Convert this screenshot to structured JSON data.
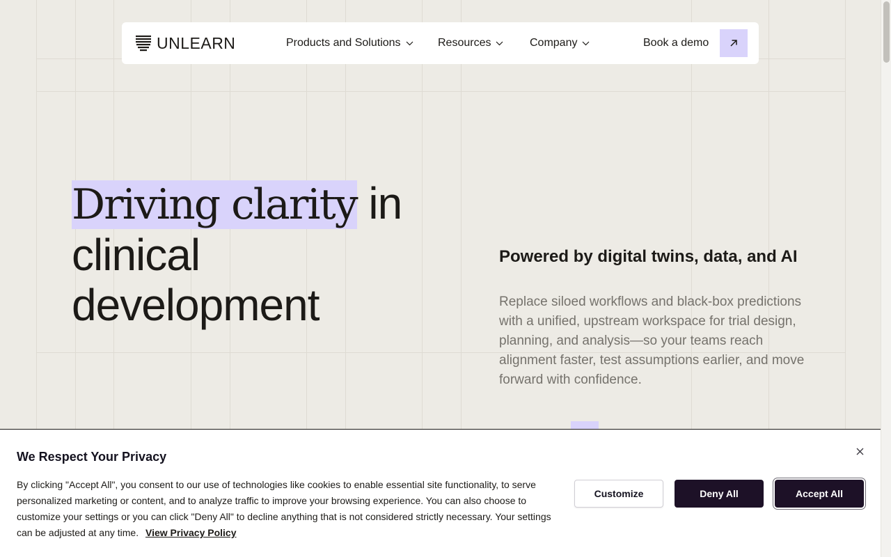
{
  "nav": {
    "logo_text": "UNLEARN",
    "items": [
      {
        "label": "Products and Solutions"
      },
      {
        "label": "Resources"
      },
      {
        "label": "Company"
      }
    ],
    "cta_label": "Book a demo"
  },
  "hero": {
    "title_highlight": "Driving clarity",
    "title_in": " in",
    "title_line2": "clinical",
    "title_line3": "development",
    "subtitle": "Powered by digital twins, data, and AI",
    "description": "Replace siloed workflows and black-box predictions with a unified, upstream workspace for trial design, planning, and analysis—so your teams reach alignment faster, test assumptions earlier, and move forward with confidence."
  },
  "cookie": {
    "title": "We Respect Your Privacy",
    "body": "By clicking \"Accept All\", you consent to our use of technologies like cookies to enable essential site functionality, to serve personalized marketing or content, and to analyze traffic to improve your browsing experience. You can also choose to customize your settings or you can click \"Deny All\" to decline anything that is not considered strictly necessary. Your settings can be adjusted at any time.",
    "policy_link": "View Privacy Policy",
    "customize_label": "Customize",
    "deny_label": "Deny All",
    "accept_label": "Accept All"
  },
  "colors": {
    "background": "#edebe5",
    "accent": "#d9d3fb",
    "dark_button": "#1d1127"
  }
}
